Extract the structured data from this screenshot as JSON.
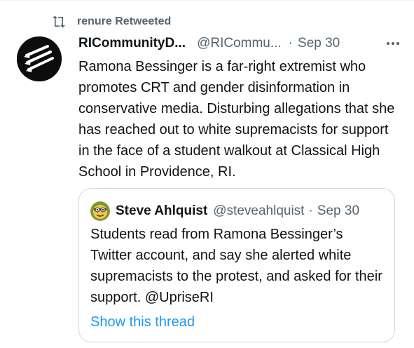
{
  "retweet": {
    "icon": "retweet-icon",
    "label": "renure Retweeted"
  },
  "tweet": {
    "avatar_icon": "three-arrows-avatar",
    "author_name": "RICommunityD...",
    "author_handle": "@RICommu...",
    "separator": "·",
    "date": "Sep 30",
    "more_icon": "more-horizontal-icon",
    "text": "Ramona Bessinger is a far-right extremist who promotes CRT and gender disinformation in conservative media. Disturbing allegations that she has reached out to white supremacists for support in the face of a student walkout at Classical High School in Providence, RI."
  },
  "quote": {
    "avatar_icon": "cartoon-face-avatar",
    "author_name": "Steve Ahlquist",
    "author_handle": "@steveahlquist",
    "separator": "·",
    "date": "Sep 30",
    "text": "Students read from Ramona Bessinger’s Twitter account, and say she alerted white supremacists to the protest, and asked for their support. @UpriseRI",
    "show_thread": "Show this thread"
  },
  "colors": {
    "text_primary": "#0f1419",
    "text_secondary": "#536471",
    "link": "#1d9bf0",
    "border": "#cfd9de"
  }
}
